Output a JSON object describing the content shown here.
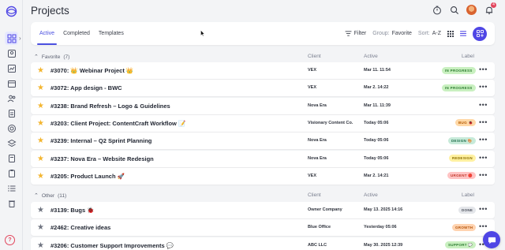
{
  "app": {
    "title": "Projects"
  },
  "tabs": [
    {
      "label": "Active",
      "active": true
    },
    {
      "label": "Completed",
      "active": false
    },
    {
      "label": "Templates",
      "active": false
    }
  ],
  "toolbar": {
    "filter_label": "Filter",
    "group_prefix": "Group:",
    "group_value": "Favorite",
    "sort_prefix": "Sort:",
    "sort_value": "A-Z"
  },
  "columns": {
    "client": "Client",
    "active": "Active",
    "label": "Label"
  },
  "groups": [
    {
      "name": "Favorite",
      "count": "(7)",
      "rows": [
        {
          "name": "#3070: 👑 Webinar Project 👑",
          "client": "VEX",
          "active": "Mar 11. 11:54",
          "label": "IN PROGRESS",
          "label_class": "lbl-inprogress",
          "starred": true
        },
        {
          "name": "#3072: App design - BWC",
          "client": "VEX",
          "active": "Mar 2. 14:22",
          "label": "IN PROGRESS",
          "label_class": "lbl-inprogress",
          "starred": true
        },
        {
          "name": "#3238: Brand Refresh – Logo & Guidelines",
          "client": "Nova Era",
          "active": "Mar 11. 11:39",
          "label": "",
          "label_class": "",
          "starred": true
        },
        {
          "name": "#3203: Client Project: ContentCraft Workflow 📝",
          "client": "Visionary Content Co.",
          "active": "Today 05:06",
          "label": "BUG 🐞",
          "label_class": "lbl-bug",
          "starred": true
        },
        {
          "name": "#3239: Internal – Q2 Sprint Planning",
          "client": "Nova Era",
          "active": "Today 05:06",
          "label": "DESIGN 🎨",
          "label_class": "lbl-design",
          "starred": true
        },
        {
          "name": "#3237: Nova Era – Website Redesign",
          "client": "Nova Era",
          "active": "Today 05:06",
          "label": "REDESIGN",
          "label_class": "lbl-redesign",
          "starred": true
        },
        {
          "name": "#3205: Product Launch 🚀",
          "client": "VEX",
          "active": "Mar 2. 14:21",
          "label": "URGENT 🔴",
          "label_class": "lbl-urgent",
          "starred": true
        }
      ]
    },
    {
      "name": "Other",
      "count": "(11)",
      "rows": [
        {
          "name": "#3139: Bugs 🐞",
          "client": "Owner Company",
          "active": "May 13. 2025 14:16",
          "label": "DONE",
          "label_class": "lbl-done",
          "starred": false
        },
        {
          "name": "#2462: Creative ideas",
          "client": "Blue Office",
          "active": "Yesterday 05:06",
          "label": "GROWTH",
          "label_class": "lbl-growth",
          "starred": false
        },
        {
          "name": "#3206: Customer Support Improvements 💬",
          "client": "ABC LLC",
          "active": "May 30. 2025 12:39",
          "label": "SUPPORT 💬",
          "label_class": "lbl-support",
          "starred": false
        }
      ]
    }
  ],
  "notifications_count": "4",
  "colors": {
    "accent": "#4f46e5",
    "star": "#f3b52f"
  }
}
